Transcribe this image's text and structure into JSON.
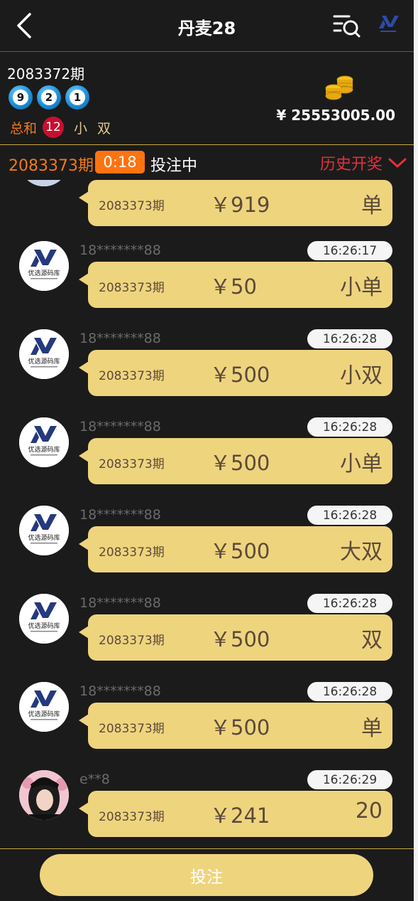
{
  "header": {
    "title": "丹麦28"
  },
  "result": {
    "period": "2083372期",
    "balls": [
      "9",
      "2",
      "1"
    ],
    "sum_label": "总和",
    "sum_value": "12",
    "size_tag": "小",
    "parity_tag": "双",
    "balance": "¥ 25553005.00"
  },
  "status": {
    "period": "2083373期",
    "countdown": "0:18",
    "state": "投注中",
    "history_label": "历史开奖"
  },
  "feed": {
    "partial": {
      "period": "2083373期",
      "amount": "￥919",
      "type": "单"
    },
    "items": [
      {
        "user": "18*******88",
        "time": "16:26:17",
        "period": "2083373期",
        "amount": "￥50",
        "type": "小单",
        "avatar": "logo"
      },
      {
        "user": "18*******88",
        "time": "16:26:28",
        "period": "2083373期",
        "amount": "￥500",
        "type": "小双",
        "avatar": "logo"
      },
      {
        "user": "18*******88",
        "time": "16:26:28",
        "period": "2083373期",
        "amount": "￥500",
        "type": "小单",
        "avatar": "logo"
      },
      {
        "user": "18*******88",
        "time": "16:26:28",
        "period": "2083373期",
        "amount": "￥500",
        "type": "大双",
        "avatar": "logo"
      },
      {
        "user": "18*******88",
        "time": "16:26:28",
        "period": "2083373期",
        "amount": "￥500",
        "type": "双",
        "avatar": "logo"
      },
      {
        "user": "18*******88",
        "time": "16:26:28",
        "period": "2083373期",
        "amount": "￥500",
        "type": "单",
        "avatar": "logo"
      },
      {
        "user": "e**8",
        "time": "16:26:29",
        "period": "2083373期",
        "amount": "￥241",
        "type": "20",
        "avatar": "photo"
      }
    ]
  },
  "logo_text": "优选源码库",
  "footer": {
    "bet_label": "投注"
  },
  "colors": {
    "background": "#1b1b1b",
    "accent_gold": "#efd47e",
    "accent_orange": "#ff7310",
    "history_red": "#e1313f",
    "ball_blue": "#1c8fd6"
  },
  "icons": [
    "back-arrow-icon",
    "list-search-icon",
    "brand-logo-icon",
    "coin-stack-icon",
    "chevron-down-icon"
  ]
}
